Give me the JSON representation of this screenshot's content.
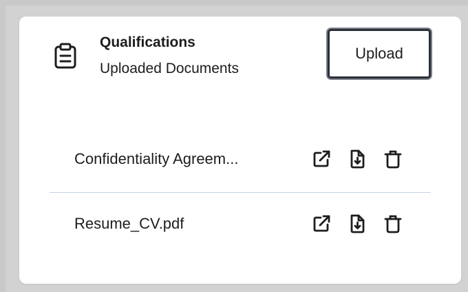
{
  "card": {
    "title": "Qualifications",
    "subtitle": "Uploaded Documents",
    "upload_label": "Upload",
    "header_icon": "clipboard-icon"
  },
  "documents": [
    {
      "name": "Confidentiality Agreem..."
    },
    {
      "name": "Resume_CV.pdf"
    }
  ],
  "row_actions": [
    "external-link-icon",
    "file-download-icon",
    "trash-icon"
  ],
  "colors": {
    "background": "#c9c9c9",
    "card": "#ffffff",
    "text": "#1d1d1d",
    "button_border": "#2b2f3a",
    "divider": "#c7d3e2"
  }
}
